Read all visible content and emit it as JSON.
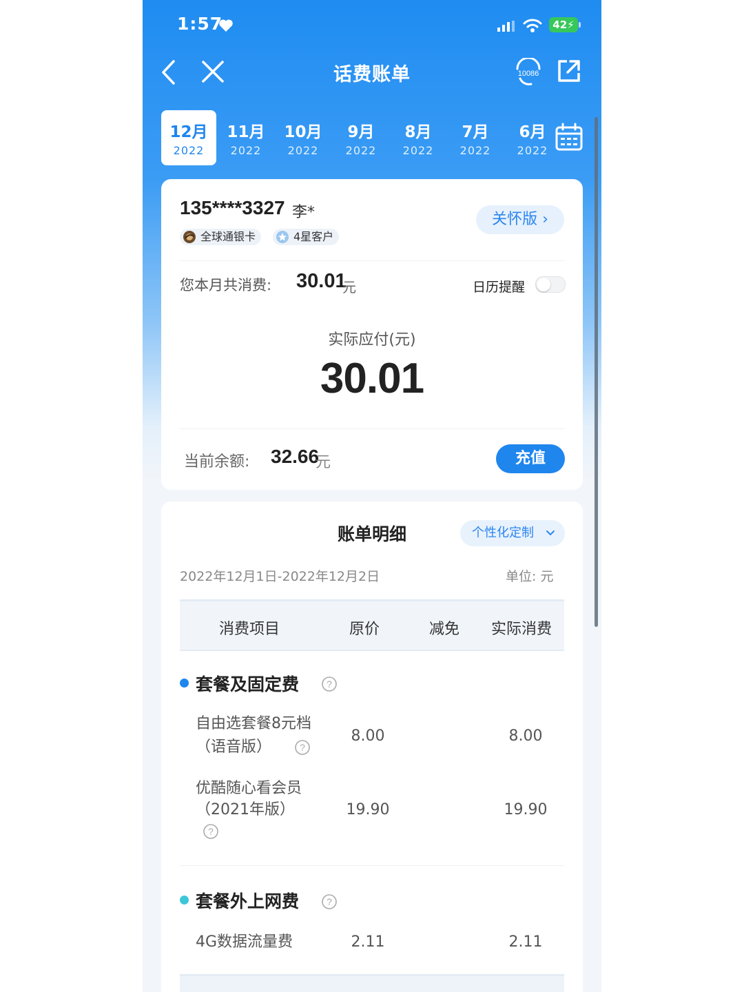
{
  "status": {
    "time": "1:57",
    "battery": "42"
  },
  "nav": {
    "title": "话费账单",
    "service_label": "10086"
  },
  "months": [
    {
      "m": "12月",
      "y": "2022"
    },
    {
      "m": "11月",
      "y": "2022"
    },
    {
      "m": "10月",
      "y": "2022"
    },
    {
      "m": "9月",
      "y": "2022"
    },
    {
      "m": "8月",
      "y": "2022"
    },
    {
      "m": "7月",
      "y": "2022"
    },
    {
      "m": "6月",
      "y": "2022"
    }
  ],
  "account": {
    "phone": "135****3327",
    "name": "李*",
    "badges": [
      "全球通银卡",
      "4星客户"
    ],
    "care_label": "关怀版"
  },
  "summary": {
    "spend_label": "您本月共消费:",
    "spend_value": "30.01",
    "unit": "元",
    "remind_label": "日历提醒",
    "remind_on": false,
    "due_label": "实际应付(元)",
    "due_value": "30.01",
    "balance_label": "当前余额:",
    "balance_value": "32.66",
    "recharge_label": "充值"
  },
  "detail": {
    "title": "账单明细",
    "custom_label": "个性化定制",
    "date_range": "2022年12月1日-2022年12月2日",
    "unit_label": "单位: 元",
    "columns": [
      "消费项目",
      "原价",
      "减免",
      "实际消费"
    ],
    "groups": [
      {
        "name": "套餐及固定费",
        "color": "#1f86ee",
        "items": [
          {
            "line1": "自由选套餐8元档",
            "line2": "（语音版）",
            "price": "8.00",
            "discount": "",
            "actual": "8.00"
          },
          {
            "line1": "优酷随心看会员",
            "line2": "（2021年版）",
            "price": "19.90",
            "discount": "",
            "actual": "19.90"
          }
        ]
      },
      {
        "name": "套餐外上网费",
        "color": "#3cc6d8",
        "items": [
          {
            "line1": "4G数据流量费",
            "line2": "",
            "price": "2.11",
            "discount": "",
            "actual": "2.11"
          }
        ]
      }
    ]
  }
}
